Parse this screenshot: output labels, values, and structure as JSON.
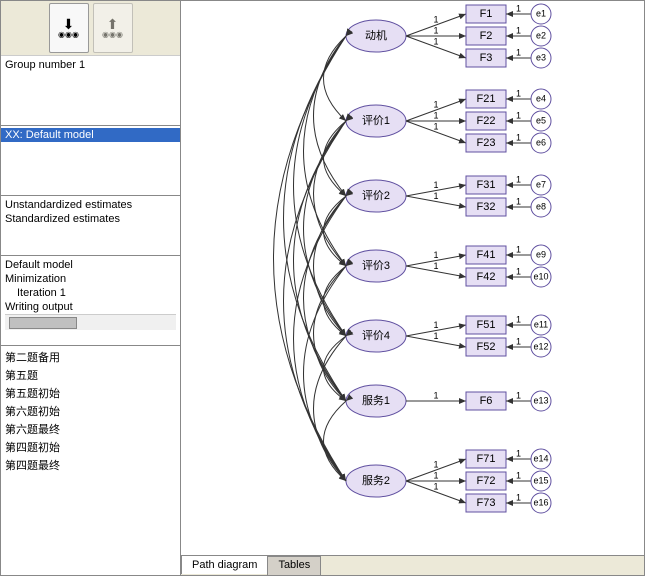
{
  "toolbar": {
    "group_label": "Group number 1",
    "model_label": "XX: Default model",
    "estimates": {
      "unstd": "Unstandardized estimates",
      "std": "Standardized estimates"
    },
    "output": {
      "line1": "Default model",
      "line2": "Minimization",
      "line3": "Iteration 1",
      "line4": "Writing output"
    },
    "files": {
      "f1": "第二题备用",
      "f2": "第五题",
      "f3": "第五题初始",
      "f4": "第六题初始",
      "f5": "第六题最终",
      "f6": "第四题初始",
      "f7": "第四题最终"
    }
  },
  "tabs": {
    "diagram": "Path diagram",
    "tables": "Tables"
  },
  "diagram": {
    "latents": {
      "l1": "动机",
      "l2": "评价1",
      "l3": "评价2",
      "l4": "评价3",
      "l5": "评价4",
      "l6": "服务1",
      "l7": "服务2"
    },
    "observed": {
      "f1": "F1",
      "f2": "F2",
      "f3": "F3",
      "f21": "F21",
      "f22": "F22",
      "f23": "F23",
      "f31": "F31",
      "f32": "F32",
      "f41": "F41",
      "f42": "F42",
      "f51": "F51",
      "f52": "F52",
      "f6": "F6",
      "f71": "F71",
      "f72": "F72",
      "f73": "F73"
    },
    "errors": {
      "e1": "e1",
      "e2": "e2",
      "e3": "e3",
      "e4": "e4",
      "e5": "e5",
      "e6": "e6",
      "e7": "e7",
      "e8": "e8",
      "e9": "e9",
      "e10": "e10",
      "e11": "e11",
      "e12": "e12",
      "e13": "e13",
      "e14": "e14",
      "e15": "e15",
      "e16": "e16"
    },
    "coef": "1"
  }
}
